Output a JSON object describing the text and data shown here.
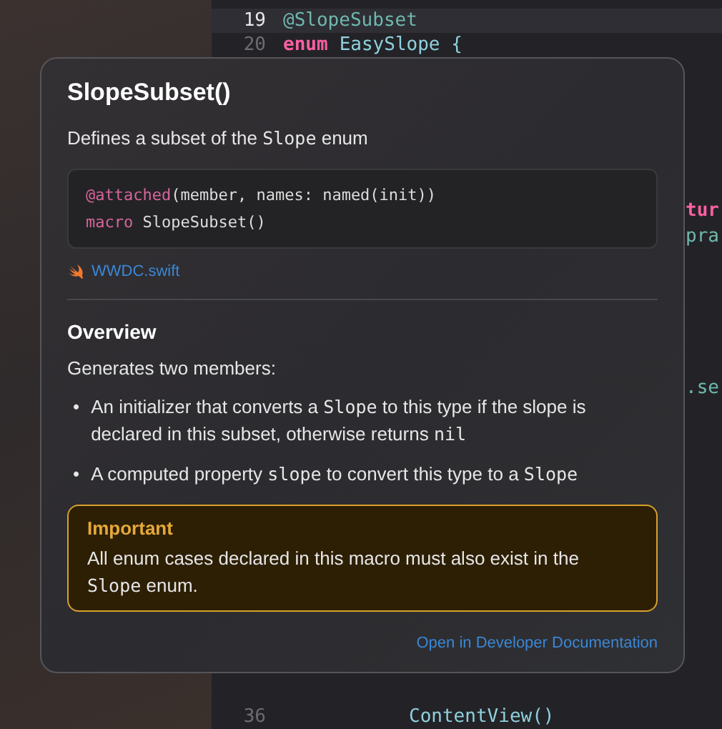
{
  "editor": {
    "lines": [
      {
        "number": "19",
        "selected": true,
        "tokens": [
          {
            "text": "@SlopeSubset",
            "kind": "attribute"
          }
        ]
      },
      {
        "number": "20",
        "selected": false,
        "tokens": [
          {
            "text": "enum",
            "kind": "keyword"
          },
          {
            "text": "EasySlope {",
            "kind": "type"
          }
        ]
      }
    ],
    "fragments": [
      {
        "text": "tur",
        "kind": "keyword"
      },
      {
        "text": "pra",
        "kind": "attribute"
      },
      {
        "text": ".se",
        "kind": "attribute"
      }
    ],
    "bottom_line": {
      "number": "36",
      "tokens": [
        {
          "text": "ContentView()",
          "kind": "type"
        }
      ]
    }
  },
  "popover": {
    "title": "SlopeSubset()",
    "summary": [
      {
        "text": "Defines a subset of the ",
        "code": false
      },
      {
        "text": "Slope",
        "code": true
      },
      {
        "text": " enum",
        "code": false
      }
    ],
    "declaration": [
      [
        {
          "text": "@attached",
          "kind": "keyword"
        },
        {
          "text": "(member, names: named(init))",
          "kind": "plain"
        }
      ],
      [
        {
          "text": "macro",
          "kind": "keyword"
        },
        {
          "text": " SlopeSubset()",
          "kind": "plain"
        }
      ]
    ],
    "source_file": "WWDC.swift",
    "section_title": "Overview",
    "intro": "Generates two members:",
    "bullets": [
      {
        "marker": "•",
        "segments": [
          {
            "text": "An initializer that converts a ",
            "code": false
          },
          {
            "text": "Slope",
            "code": true
          },
          {
            "text": " to this type if the slope is declared in this subset, otherwise returns ",
            "code": false
          },
          {
            "text": "nil",
            "code": true
          }
        ]
      },
      {
        "marker": "•",
        "segments": [
          {
            "text": "A computed property ",
            "code": false
          },
          {
            "text": "slope",
            "code": true
          },
          {
            "text": " to convert this type to a ",
            "code": false
          },
          {
            "text": "Slope",
            "code": true
          }
        ]
      }
    ],
    "callout": {
      "title": "Important",
      "body": [
        {
          "text": "All enum cases declared in this macro must also exist in the ",
          "code": false
        },
        {
          "text": "Slope",
          "code": true
        },
        {
          "text": " enum.",
          "code": false
        }
      ]
    },
    "doc_link": "Open in Developer Documentation"
  }
}
